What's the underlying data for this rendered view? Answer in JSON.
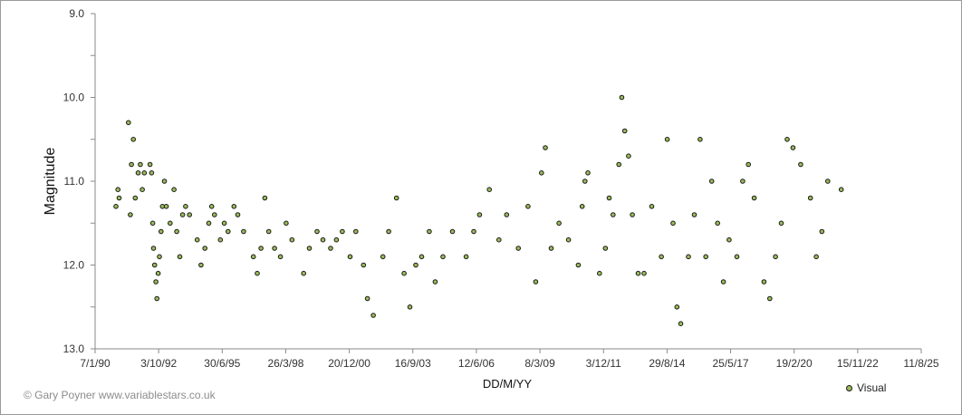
{
  "chart_data": {
    "type": "scatter",
    "xlabel": "DD/M/YY",
    "ylabel": "Magnitude",
    "x_tick_labels": [
      "7/1/90",
      "3/10/92",
      "30/6/95",
      "26/3/98",
      "20/12/00",
      "16/9/03",
      "12/6/06",
      "8/3/09",
      "3/12/11",
      "29/8/14",
      "25/5/17",
      "19/2/20",
      "15/11/22",
      "11/8/25"
    ],
    "y_tick_labels": [
      "9.0",
      "10.0",
      "11.0",
      "12.0",
      "13.0"
    ],
    "xlim": [
      "1990-01-07",
      "2025-08-11"
    ],
    "ylim": [
      13.0,
      9.0
    ],
    "y_inverted": true,
    "gridlines": false,
    "legend_position": "bottom-right",
    "marker_color": "#9bbb59",
    "marker_edge_color": "#1a1a1a",
    "series": [
      {
        "name": "Visual",
        "points": [
          [
            "1990-12-01",
            11.3
          ],
          [
            "1991-01-01",
            11.1
          ],
          [
            "1991-01-20",
            11.2
          ],
          [
            "1991-06-15",
            10.3
          ],
          [
            "1991-07-15",
            11.4
          ],
          [
            "1991-08-01",
            10.8
          ],
          [
            "1991-09-01",
            10.5
          ],
          [
            "1991-10-01",
            11.2
          ],
          [
            "1991-11-15",
            10.9
          ],
          [
            "1991-12-20",
            10.8
          ],
          [
            "1992-01-20",
            11.1
          ],
          [
            "1992-02-20",
            10.9
          ],
          [
            "1992-05-20",
            10.8
          ],
          [
            "1992-06-15",
            10.9
          ],
          [
            "1992-07-01",
            11.5
          ],
          [
            "1992-07-15",
            11.8
          ],
          [
            "1992-08-01",
            12.0
          ],
          [
            "1992-08-20",
            12.2
          ],
          [
            "1992-09-05",
            12.4
          ],
          [
            "1992-09-25",
            12.1
          ],
          [
            "1992-10-15",
            11.9
          ],
          [
            "1992-11-10",
            11.6
          ],
          [
            "1992-12-01",
            11.3
          ],
          [
            "1993-01-01",
            11.0
          ],
          [
            "1993-02-01",
            11.3
          ],
          [
            "1993-04-01",
            11.5
          ],
          [
            "1993-06-01",
            11.1
          ],
          [
            "1993-07-15",
            11.6
          ],
          [
            "1993-09-01",
            11.9
          ],
          [
            "1993-10-15",
            11.4
          ],
          [
            "1993-12-01",
            11.3
          ],
          [
            "1994-02-01",
            11.4
          ],
          [
            "1994-06-01",
            11.7
          ],
          [
            "1994-08-01",
            12.0
          ],
          [
            "1994-10-01",
            11.8
          ],
          [
            "1994-12-01",
            11.5
          ],
          [
            "1995-01-15",
            11.3
          ],
          [
            "1995-03-01",
            11.4
          ],
          [
            "1995-06-01",
            11.7
          ],
          [
            "1995-08-01",
            11.5
          ],
          [
            "1995-10-01",
            11.6
          ],
          [
            "1996-01-01",
            11.3
          ],
          [
            "1996-03-01",
            11.4
          ],
          [
            "1996-06-01",
            11.6
          ],
          [
            "1996-11-01",
            11.9
          ],
          [
            "1997-01-01",
            12.1
          ],
          [
            "1997-03-01",
            11.8
          ],
          [
            "1997-05-01",
            11.2
          ],
          [
            "1997-07-01",
            11.6
          ],
          [
            "1997-10-01",
            11.8
          ],
          [
            "1998-01-01",
            11.9
          ],
          [
            "1998-04-01",
            11.5
          ],
          [
            "1998-07-01",
            11.7
          ],
          [
            "1999-01-01",
            12.1
          ],
          [
            "1999-04-01",
            11.8
          ],
          [
            "1999-08-01",
            11.6
          ],
          [
            "1999-11-01",
            11.7
          ],
          [
            "2000-03-01",
            11.8
          ],
          [
            "2000-06-01",
            11.7
          ],
          [
            "2000-09-01",
            11.6
          ],
          [
            "2001-01-01",
            11.9
          ],
          [
            "2001-04-01",
            11.6
          ],
          [
            "2001-08-01",
            12.0
          ],
          [
            "2001-10-01",
            12.4
          ],
          [
            "2002-01-01",
            12.6
          ],
          [
            "2002-06-01",
            11.9
          ],
          [
            "2002-09-01",
            11.6
          ],
          [
            "2003-01-01",
            11.2
          ],
          [
            "2003-05-01",
            12.1
          ],
          [
            "2003-08-01",
            12.5
          ],
          [
            "2003-11-01",
            12.0
          ],
          [
            "2004-02-01",
            11.9
          ],
          [
            "2004-06-01",
            11.6
          ],
          [
            "2004-09-01",
            12.2
          ],
          [
            "2005-01-01",
            11.9
          ],
          [
            "2005-06-01",
            11.6
          ],
          [
            "2006-01-01",
            11.9
          ],
          [
            "2006-05-01",
            11.6
          ],
          [
            "2006-08-01",
            11.4
          ],
          [
            "2007-01-01",
            11.1
          ],
          [
            "2007-06-01",
            11.7
          ],
          [
            "2007-10-01",
            11.4
          ],
          [
            "2008-04-01",
            11.8
          ],
          [
            "2008-09-01",
            11.3
          ],
          [
            "2009-01-01",
            12.2
          ],
          [
            "2009-04-01",
            10.9
          ],
          [
            "2009-06-01",
            10.6
          ],
          [
            "2009-09-01",
            11.8
          ],
          [
            "2010-01-01",
            11.5
          ],
          [
            "2010-06-01",
            11.7
          ],
          [
            "2010-11-01",
            12.0
          ],
          [
            "2011-01-01",
            11.3
          ],
          [
            "2011-02-15",
            11.0
          ],
          [
            "2011-04-01",
            10.9
          ],
          [
            "2011-10-01",
            12.1
          ],
          [
            "2012-01-01",
            11.8
          ],
          [
            "2012-03-01",
            11.2
          ],
          [
            "2012-05-01",
            11.4
          ],
          [
            "2012-08-01",
            10.8
          ],
          [
            "2012-09-15",
            10.0
          ],
          [
            "2012-11-01",
            10.4
          ],
          [
            "2013-01-01",
            10.7
          ],
          [
            "2013-03-01",
            11.4
          ],
          [
            "2013-06-01",
            12.1
          ],
          [
            "2013-09-01",
            12.1
          ],
          [
            "2014-01-01",
            11.3
          ],
          [
            "2014-06-01",
            11.9
          ],
          [
            "2014-09-01",
            10.5
          ],
          [
            "2014-12-01",
            11.5
          ],
          [
            "2015-02-01",
            12.5
          ],
          [
            "2015-04-01",
            12.7
          ],
          [
            "2015-08-01",
            11.9
          ],
          [
            "2015-11-01",
            11.4
          ],
          [
            "2016-02-01",
            10.5
          ],
          [
            "2016-05-01",
            11.9
          ],
          [
            "2016-08-01",
            11.0
          ],
          [
            "2016-11-01",
            11.5
          ],
          [
            "2017-02-01",
            12.2
          ],
          [
            "2017-05-01",
            11.7
          ],
          [
            "2017-09-01",
            11.9
          ],
          [
            "2017-12-01",
            11.0
          ],
          [
            "2018-03-01",
            10.8
          ],
          [
            "2018-06-01",
            11.2
          ],
          [
            "2018-11-01",
            12.2
          ],
          [
            "2019-02-01",
            12.4
          ],
          [
            "2019-05-01",
            11.9
          ],
          [
            "2019-08-01",
            11.5
          ],
          [
            "2019-11-01",
            10.5
          ],
          [
            "2020-02-01",
            10.6
          ],
          [
            "2020-06-01",
            10.8
          ],
          [
            "2020-11-01",
            11.2
          ],
          [
            "2021-02-01",
            11.9
          ],
          [
            "2021-05-01",
            11.6
          ],
          [
            "2021-08-01",
            11.0
          ],
          [
            "2022-03-01",
            11.1
          ]
        ]
      }
    ]
  },
  "credit": "© Gary Poyner www.variablestars.co.uk",
  "legend": {
    "label": "Visual"
  }
}
